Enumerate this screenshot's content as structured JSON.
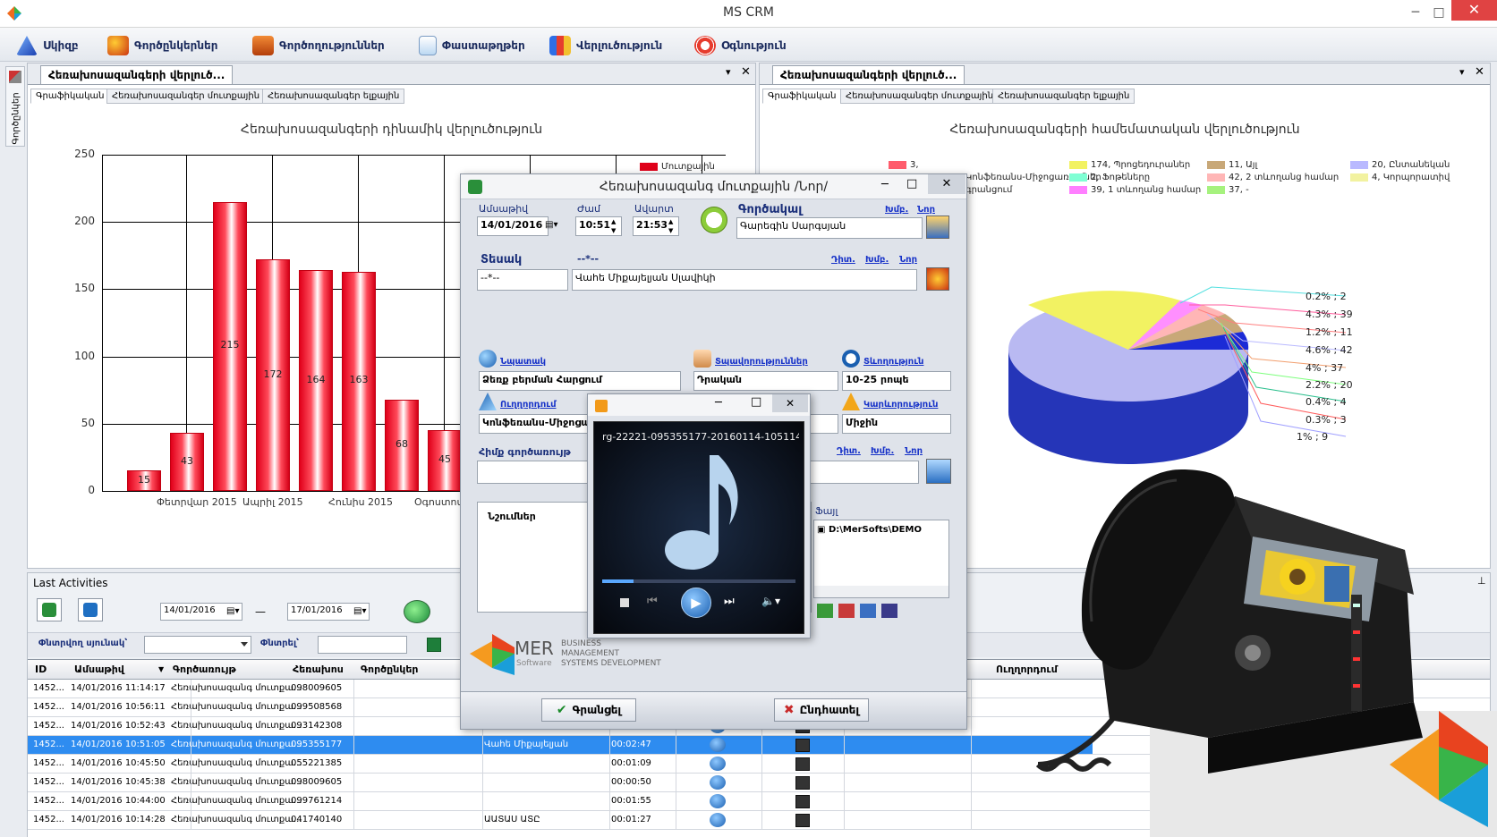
{
  "app": {
    "title": "MS CRM"
  },
  "menu": [
    "Սկիզբ",
    "Գործընկերներ",
    "Գործողություններ",
    "Փաստաթղթեր",
    "Վերլուծություն",
    "Օգնություն"
  ],
  "side_tab": "Գործընկեր",
  "left_panel": {
    "tab": "Հեռախոսազանգերի վերլուծ...",
    "subtabs": [
      "Գրաֆիկական",
      "Հեռախոսազանգեր մուտքային",
      "Հեռախոսազանգեր ելքային"
    ],
    "chart_title": "Հեռախոսազանգերի դինամիկ վերլուծություն",
    "legend": "Մուտքային"
  },
  "right_panel": {
    "tab": "Հեռախոսազանգերի վերլուծ...",
    "subtabs": [
      "Գրաֆիկական",
      "Հեռախոսազանգեր մուտքային",
      "Հեռախոսազանգեր ելքային"
    ],
    "chart_title": "Հեռախոսազանգերի համեմատական վերլուծություն",
    "legend": [
      "3,",
      "Կոնֆեռանս-Միջոցառումներ",
      "գրանցում",
      "174, Պրոցեդուրաներ",
      "2, Ֆոթեները",
      "39, 1 տևողանց համար",
      "11, Այլ",
      "42, 2 տևողանց համար",
      "37, -",
      "20, Ընտանեկան",
      "4, Կորպորատիվ"
    ]
  },
  "chart_data": [
    {
      "type": "bar",
      "title": "Հեռախոսազանգերի դինամիկ վերլուծություն",
      "series": [
        {
          "name": "Մուտքային",
          "values": [
            15,
            43,
            215,
            172,
            164,
            163,
            68,
            45
          ]
        }
      ],
      "categories": [
        "",
        "Փետրվար 2015",
        "",
        "Ապրիլ 2015",
        "",
        "Հունիս 2015",
        "",
        "Օգոստոս 2015"
      ],
      "yticks": [
        0,
        50,
        100,
        150,
        200,
        250
      ],
      "ylim": [
        0,
        250
      ],
      "grid": true,
      "legend": "top-right"
    },
    {
      "type": "pie",
      "title": "Հեռախոսազանգերի համեմատական վերլուծություն",
      "labels": [
        "0.2% ; 2",
        "4.3% ; 39",
        "1.2% ; 11",
        "4.6% ; 42",
        "4% ; 37",
        "2.2% ; 20",
        "0.4% ; 4",
        "0.3% ; 3",
        "1% ; 9"
      ],
      "colors": [
        "#1c2bd6",
        "#f2f262",
        "#b9b9ff",
        "#ff8fff",
        "#ffb6b6",
        "#7fffd4",
        "#f2a0a0",
        "#a6f27e",
        "#c8a878"
      ]
    }
  ],
  "call_dialog": {
    "title": "Հեռախոսազանգ մուտքային /Նոր/",
    "date_label": "Ամսաթիվ",
    "date": "14/01/2016",
    "start_label": "Ժամ",
    "start": "10:51",
    "end_label": "Ավարտ",
    "end": "21:53",
    "employee_label": "Գործակալ",
    "employee": "Գարեգին Սարգսյան",
    "employee_links": [
      "Խմբ.",
      "Նոր"
    ],
    "type_label": "Տեսակ",
    "type_value": "--*--",
    "type_select": "--*--",
    "contact": "Վահե Միքայելյան Սլավիկի",
    "contact_links": [
      "Դիտ.",
      "Խմբ.",
      "Նոր"
    ],
    "purpose_label": "Նպատակ",
    "purpose": "Ձեռք բերման Հարցում",
    "status_label": "Տպավորություններ",
    "status": "Դրական",
    "duration_label": "Տևողություն",
    "duration": "10-25 րոպե",
    "direction_label": "Ուղղորդում",
    "direction": "Կոնֆեռանս-Միջոցառում",
    "priority_label": "Կարևորություն",
    "priority": "Միջին",
    "operator_label": "Հիմք գործառույթ",
    "operator_links": [
      "Դիտ.",
      "Խմբ.",
      "Նոր"
    ],
    "notes_label": "Նշումներ",
    "file_label": "Ֆայլ",
    "file_path": "D:\\MerSofts\\DEMO",
    "logo_main": "MER",
    "logo_sub": "Software",
    "logo_tagline": [
      "BUSINESS",
      "MANAGEMENT",
      "SYSTEMS DEVELOPMENT"
    ],
    "save": "Գրանցել",
    "cancel": "Ընդհատել"
  },
  "player": {
    "filename": "rg-22221-095355177-20160114-105114-1..."
  },
  "activities": {
    "title": "Last Activities",
    "date_from": "14/01/2016",
    "dash": "—",
    "date_to": "17/01/2016",
    "filter_field_label": "Փնտրվող սյունակ՝",
    "filter_label": "Փնտրել՝",
    "columns": [
      "ID",
      "Ամսաթիվ",
      "Գործառույթ",
      "Հեռախոս",
      "Գործընկեր",
      "Ուղղորդում"
    ],
    "rows": [
      {
        "id": "1452...",
        "date": "14/01/2016 11:14:17",
        "op": "Հեռախոսազանգ մուտքա...",
        "phone": "098009605",
        "partner": "",
        "dur": ""
      },
      {
        "id": "1452...",
        "date": "14/01/2016 10:56:11",
        "op": "Հեռախոսազանգ մուտքա...",
        "phone": "099508568",
        "partner": "",
        "dur": ""
      },
      {
        "id": "1452...",
        "date": "14/01/2016 10:52:43",
        "op": "Հեռախոսազանգ մուտքա...",
        "phone": "093142308",
        "partner": "",
        "dur": ""
      },
      {
        "id": "1452...",
        "date": "14/01/2016 10:51:05",
        "op": "Հեռախոսազանգ մուտքա...",
        "phone": "095355177",
        "partner": "Վահե Միքայելյան",
        "dur": "00:02:47"
      },
      {
        "id": "1452...",
        "date": "14/01/2016 10:45:50",
        "op": "Հեռախոսազանգ մուտքա...",
        "phone": "055221385",
        "partner": "",
        "dur": "00:01:09"
      },
      {
        "id": "1452...",
        "date": "14/01/2016 10:45:38",
        "op": "Հեռախոսազանգ մուտքա...",
        "phone": "098009605",
        "partner": "",
        "dur": "00:00:50"
      },
      {
        "id": "1452...",
        "date": "14/01/2016 10:44:00",
        "op": "Հեռախոսազանգ մուտքա...",
        "phone": "099761214",
        "partner": "",
        "dur": "00:01:55"
      },
      {
        "id": "1452...",
        "date": "14/01/2016 10:14:28",
        "op": "Հեռախոսազանգ մուտքա...",
        "phone": "041740140",
        "partner": "ԱԱՏԱՍ ԱՏԸ",
        "dur": "00:01:27"
      }
    ]
  }
}
